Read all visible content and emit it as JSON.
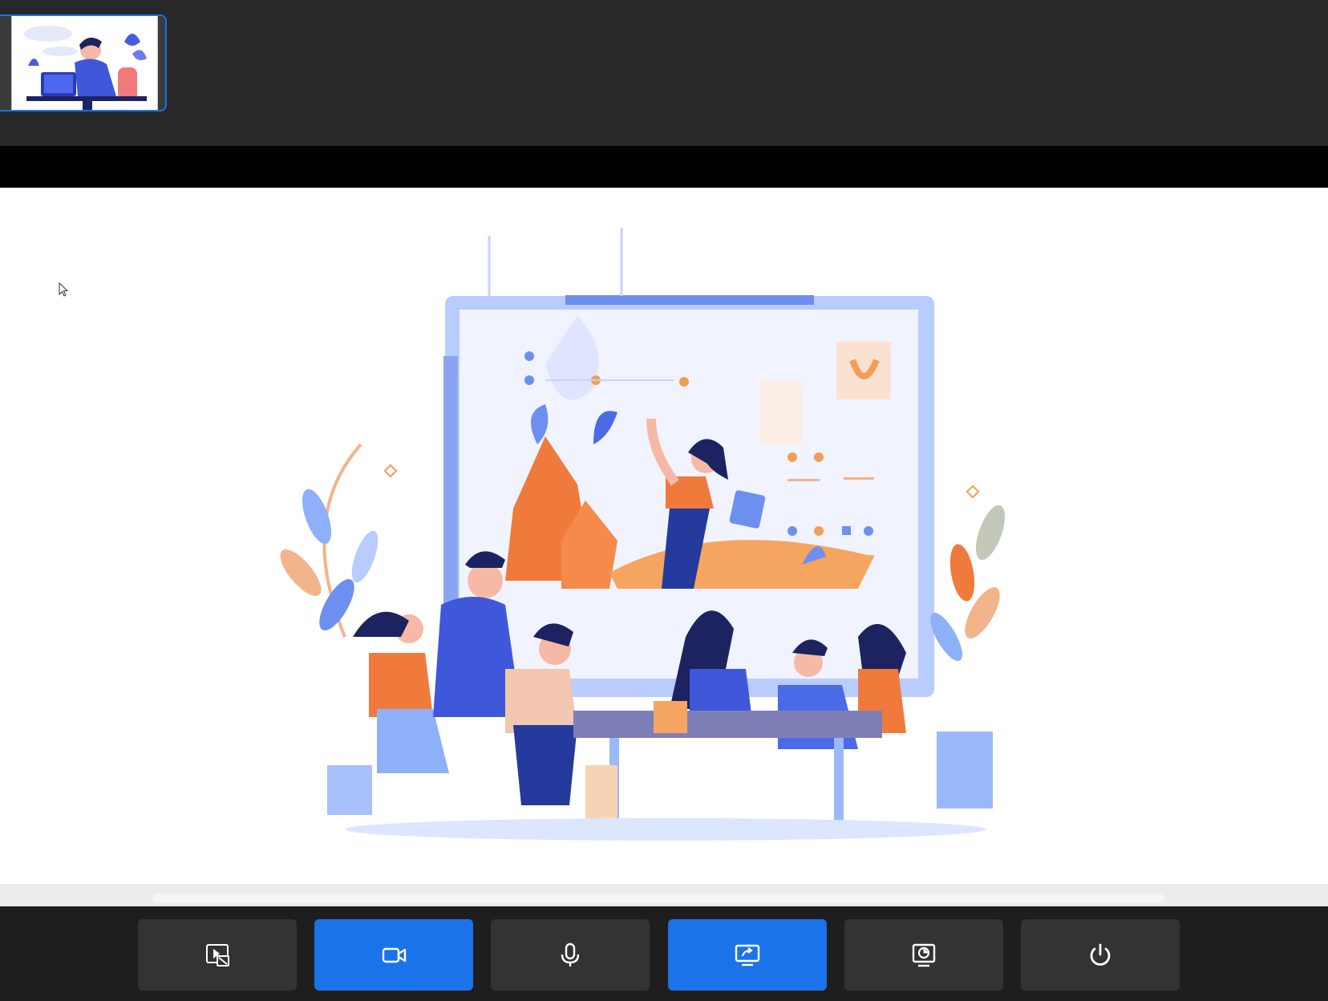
{
  "window": {
    "top_strip_color": "#282828",
    "stage_color": "#ffffff"
  },
  "self_view": {
    "icon": "person-at-laptop-illustration"
  },
  "shared_screen": {
    "icon": "team-meeting-illustration"
  },
  "toolbar": {
    "accent_color": "#1a73e8",
    "buttons": [
      {
        "name": "picture-in-picture",
        "icon": "pip-off-icon",
        "active": false
      },
      {
        "name": "camera",
        "icon": "video-camera-icon",
        "active": true
      },
      {
        "name": "microphone",
        "icon": "microphone-icon",
        "active": false
      },
      {
        "name": "share-screen",
        "icon": "screen-share-icon",
        "active": true
      },
      {
        "name": "presentation",
        "icon": "presentation-chart-icon",
        "active": false
      },
      {
        "name": "leave",
        "icon": "power-icon",
        "active": false
      }
    ]
  }
}
